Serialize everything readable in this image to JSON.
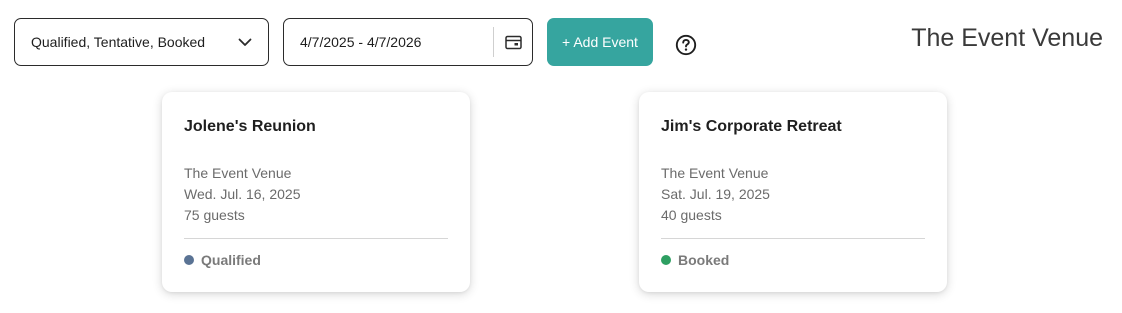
{
  "toolbar": {
    "status_filter": {
      "value": "Qualified, Tentative, Booked",
      "icon": "chevron-down-icon"
    },
    "date_range": {
      "value": "4/7/2025 - 4/7/2026",
      "icon": "calendar-icon"
    },
    "add_event_label": "+ Add Event",
    "help_icon": "question-circle-icon",
    "venue_title": "The Event Venue"
  },
  "colors": {
    "accent": "#36a59f",
    "qualified": "#5a7394",
    "booked": "#2e9f62"
  },
  "events": [
    {
      "name": "Jolene's Reunion",
      "venue": "The Event Venue",
      "date": "Wed. Jul. 16, 2025",
      "guests": "75 guests",
      "status": "Qualified",
      "status_color": "#5a7394"
    },
    {
      "name": "Jim's Corporate Retreat",
      "venue": "The Event Venue",
      "date": "Sat. Jul. 19, 2025",
      "guests": "40 guests",
      "status": "Booked",
      "status_color": "#2e9f62"
    }
  ]
}
